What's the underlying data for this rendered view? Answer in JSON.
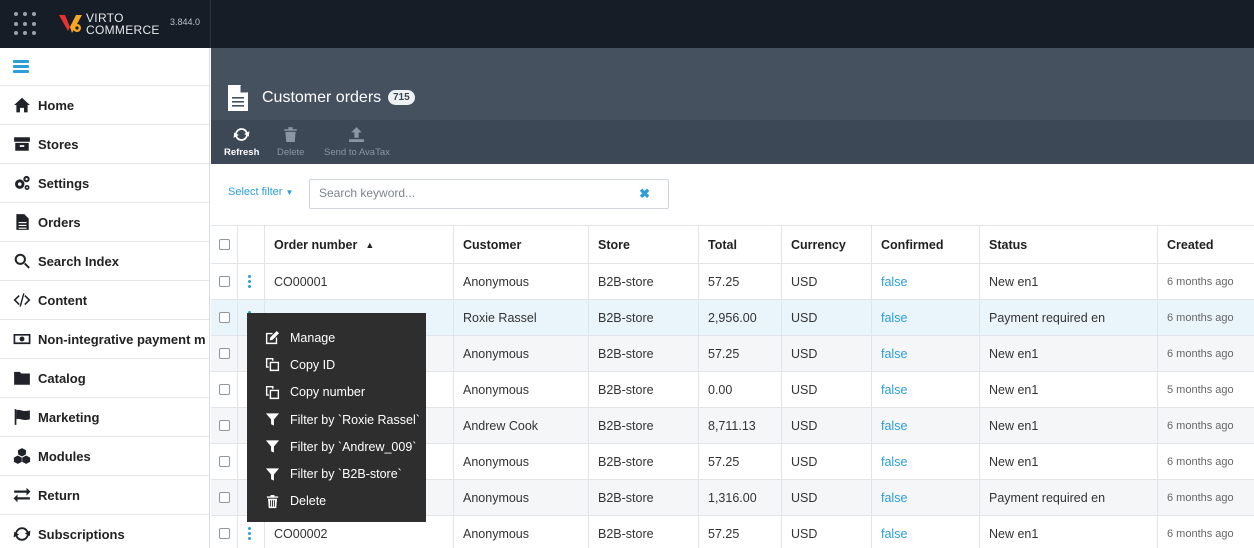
{
  "app": {
    "logo_line1": "VIRTO",
    "logo_line2": "COMMERCE",
    "version": "3.844.0"
  },
  "sidebar": {
    "items": [
      {
        "label": "Home",
        "icon": "home-icon"
      },
      {
        "label": "Stores",
        "icon": "archive-icon"
      },
      {
        "label": "Settings",
        "icon": "gears-icon"
      },
      {
        "label": "Orders",
        "icon": "document-icon"
      },
      {
        "label": "Search Index",
        "icon": "search-icon"
      },
      {
        "label": "Content",
        "icon": "code-icon"
      },
      {
        "label": "Non-integrative payment m",
        "icon": "money-icon"
      },
      {
        "label": "Catalog",
        "icon": "folder-icon"
      },
      {
        "label": "Marketing",
        "icon": "flag-icon"
      },
      {
        "label": "Modules",
        "icon": "cubes-icon"
      },
      {
        "label": "Return",
        "icon": "exchange-icon"
      },
      {
        "label": "Subscriptions",
        "icon": "refresh-icon"
      }
    ]
  },
  "blade": {
    "title": "Customer orders",
    "count": "715"
  },
  "toolbar": {
    "refresh": "Refresh",
    "delete": "Delete",
    "send_to_avatax": "Send to AvaTax"
  },
  "filter": {
    "select_filter": "Select filter",
    "search_placeholder": "Search keyword...",
    "clear_symbol": "✖"
  },
  "grid": {
    "columns": {
      "order_number": "Order number",
      "customer": "Customer",
      "store": "Store",
      "total": "Total",
      "currency": "Currency",
      "confirmed": "Confirmed",
      "status": "Status",
      "created": "Created"
    },
    "rows": [
      {
        "order_number": "CO00001",
        "customer": "Anonymous",
        "store": "B2B-store",
        "total": "57.25",
        "currency": "USD",
        "confirmed": "false",
        "status": "New en1",
        "created": "6 months ago"
      },
      {
        "order_number": "",
        "customer": "Roxie Rassel",
        "store": "B2B-store",
        "total": "2,956.00",
        "currency": "USD",
        "confirmed": "false",
        "status": "Payment required en",
        "created": "6 months ago"
      },
      {
        "order_number": "",
        "customer": "Anonymous",
        "store": "B2B-store",
        "total": "57.25",
        "currency": "USD",
        "confirmed": "false",
        "status": "New en1",
        "created": "6 months ago"
      },
      {
        "order_number": "",
        "customer": "Anonymous",
        "store": "B2B-store",
        "total": "0.00",
        "currency": "USD",
        "confirmed": "false",
        "status": "New en1",
        "created": "5 months ago"
      },
      {
        "order_number": "",
        "customer": "Andrew Cook",
        "store": "B2B-store",
        "total": "8,711.13",
        "currency": "USD",
        "confirmed": "false",
        "status": "New en1",
        "created": "6 months ago"
      },
      {
        "order_number": "",
        "customer": "Anonymous",
        "store": "B2B-store",
        "total": "57.25",
        "currency": "USD",
        "confirmed": "false",
        "status": "New en1",
        "created": "6 months ago"
      },
      {
        "order_number": "",
        "customer": "Anonymous",
        "store": "B2B-store",
        "total": "1,316.00",
        "currency": "USD",
        "confirmed": "false",
        "status": "Payment required en",
        "created": "6 months ago"
      },
      {
        "order_number": "CO00002",
        "customer": "Anonymous",
        "store": "B2B-store",
        "total": "57.25",
        "currency": "USD",
        "confirmed": "false",
        "status": "New en1",
        "created": "6 months ago"
      }
    ]
  },
  "context_menu": {
    "items": [
      {
        "label": "Manage",
        "icon": "edit-icon"
      },
      {
        "label": "Copy ID",
        "icon": "copy-icon"
      },
      {
        "label": "Copy number",
        "icon": "copy-icon"
      },
      {
        "label": "Filter by `Roxie Rassel`",
        "icon": "filter-icon"
      },
      {
        "label": "Filter by `Andrew_009`",
        "icon": "filter-icon"
      },
      {
        "label": "Filter by `B2B-store`",
        "icon": "filter-icon"
      },
      {
        "label": "Delete",
        "icon": "trash-icon"
      }
    ]
  },
  "colors": {
    "accent": "#2c9fd9",
    "topbar": "#171d26",
    "blade_header": "#45515f",
    "toolbar": "#3c4856",
    "context_menu": "#2e2e2e"
  }
}
